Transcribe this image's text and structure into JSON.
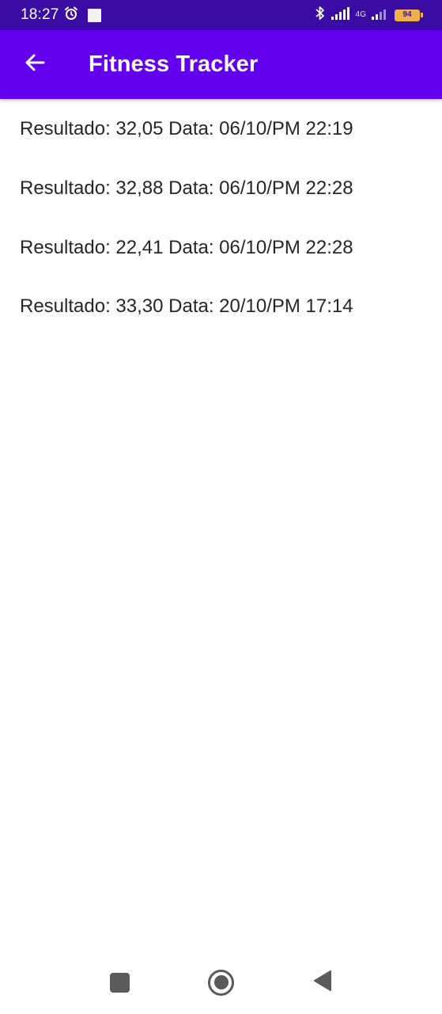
{
  "status_bar": {
    "time": "18:27",
    "network_label": "4G",
    "battery_level": "94",
    "icons": [
      "alarm-icon",
      "notification-square-icon",
      "bluetooth-icon",
      "signal-icon",
      "signal-icon-secondary",
      "battery-icon"
    ]
  },
  "app_bar": {
    "title": "Fitness Tracker",
    "back_icon": "arrow-left-icon",
    "background_color": "#6200ee"
  },
  "results": [
    {
      "text": "Resultado: 32,05 Data: 06/10/PM 22:19"
    },
    {
      "text": "Resultado: 32,88 Data: 06/10/PM 22:28"
    },
    {
      "text": "Resultado: 22,41 Data: 06/10/PM 22:28"
    },
    {
      "text": "Resultado: 33,30 Data: 20/10/PM 17:14"
    }
  ],
  "nav_bar": {
    "icons": [
      "recents-icon",
      "home-icon",
      "back-icon"
    ]
  }
}
